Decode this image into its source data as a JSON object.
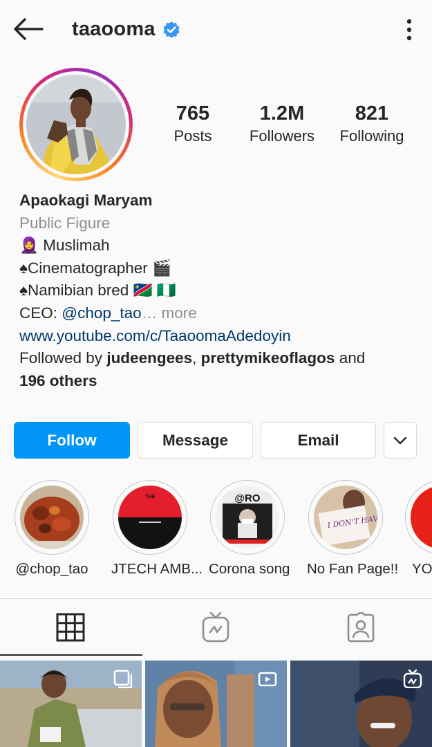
{
  "header": {
    "username": "taaooma",
    "verified": true,
    "back_icon": "arrow-left-icon",
    "options_icon": "more-vertical-icon"
  },
  "stats": {
    "posts_count": "765",
    "posts_label": "Posts",
    "followers_count": "1.2M",
    "followers_label": "Followers",
    "following_count": "821",
    "following_label": "Following"
  },
  "bio": {
    "display_name": "Apaokagi Maryam",
    "category": "Public Figure",
    "line1": "🧕 Muslimah",
    "line2": "♠Cinematographer 🎬",
    "line3": "♠Namibian bred 🇳🇦 🇳🇬",
    "ceo_prefix": "CEO: ",
    "ceo_handle": "@chop_tao",
    "ellipsis_more": "… more",
    "website": "www.youtube.com/c/TaaoomaAdedoyin",
    "followed_by_prefix": "Followed by ",
    "followed_by_user1": "judeengees",
    "followed_by_sep": ", ",
    "followed_by_user2": "prettymikeoflagos",
    "followed_by_and": " and",
    "followed_by_others": "196 others"
  },
  "actions": {
    "follow_label": "Follow",
    "message_label": "Message",
    "email_label": "Email",
    "more_icon": "chevron-down-icon"
  },
  "highlights": [
    {
      "label": "@chop_tao"
    },
    {
      "label": "JTECH AMB...",
      "caption": "THE"
    },
    {
      "label": "Corona song",
      "caption": "@RO"
    },
    {
      "label": "No Fan Page!!",
      "caption": "I DON'T HAVE A FAN PAGE"
    },
    {
      "label": "YOU"
    }
  ],
  "tabs": [
    {
      "name": "grid",
      "icon": "grid-icon",
      "active": true
    },
    {
      "name": "igtv",
      "icon": "igtv-icon",
      "active": false
    },
    {
      "name": "tagged",
      "icon": "tagged-user-icon",
      "active": false
    }
  ],
  "colors": {
    "accent": "#0095f6",
    "text": "#262626",
    "muted": "#8e8e8e",
    "link": "#00376b",
    "verified": "#3897f0"
  }
}
